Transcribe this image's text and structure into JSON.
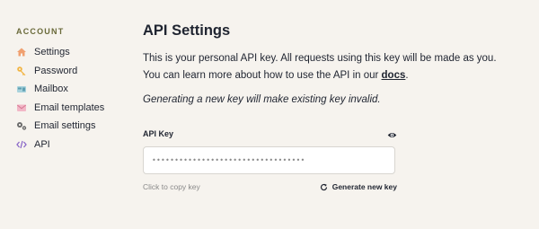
{
  "sidebar": {
    "heading": "ACCOUNT",
    "items": [
      {
        "label": "Settings",
        "icon": "home-icon",
        "color": "#f0a070"
      },
      {
        "label": "Password",
        "icon": "key-icon",
        "color": "#f2b544"
      },
      {
        "label": "Mailbox",
        "icon": "mailbox-icon",
        "color": "#7db8c8"
      },
      {
        "label": "Email templates",
        "icon": "envelope-icon",
        "color": "#e99ab0"
      },
      {
        "label": "Email settings",
        "icon": "gears-icon",
        "color": "#6b6b6b"
      },
      {
        "label": "API",
        "icon": "code-icon",
        "color": "#8a68c8"
      }
    ]
  },
  "main": {
    "title": "API Settings",
    "desc_line1": "This is your personal API key. All requests using this key will be made as you.",
    "desc_line2_pre": "You can learn more about how to use the API in our ",
    "desc_link": "docs",
    "desc_line2_post": ".",
    "warning": "Generating a new key will make existing key invalid.",
    "field_label": "API Key",
    "key_value": "••••••••••••••••••••••••••••••••••",
    "copy_hint": "Click to copy key",
    "regenerate_label": "Generate new key"
  }
}
